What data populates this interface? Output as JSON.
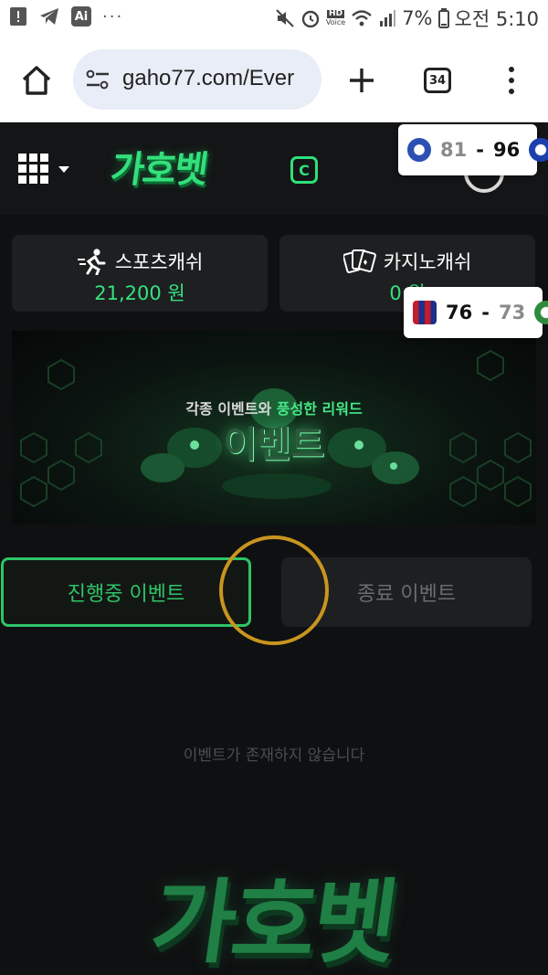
{
  "status_bar": {
    "battery": "7%",
    "time": "오전 5:10",
    "ai_label": "Ai",
    "hd_label": "HD",
    "voice_label": "Voice",
    "more": "···"
  },
  "browser": {
    "url": "gaho77.com/Ever",
    "tab_count": "34"
  },
  "header": {
    "logo": "가호벳",
    "copy_icon": "C"
  },
  "cash": {
    "sports_label": "스포츠캐쉬",
    "sports_value": "21,200 원",
    "casino_label": "카지노캐쉬",
    "casino_value": "0 원"
  },
  "banner": {
    "subtitle_pre": "각종 이벤트와 ",
    "subtitle_hl": "풍성한 리워드",
    "title": "이벤트"
  },
  "tabs": {
    "active": "진행중 이벤트",
    "ended": "종료 이벤트"
  },
  "empty_message": "이벤트가 존재하지 않습니다",
  "footer_logo": "가호벳",
  "scores": [
    {
      "left": "81",
      "right": "96"
    },
    {
      "left": "76",
      "right": "73"
    }
  ],
  "colors": {
    "accent": "#2dc467",
    "background": "#0f1011",
    "card": "#1d1f21"
  }
}
